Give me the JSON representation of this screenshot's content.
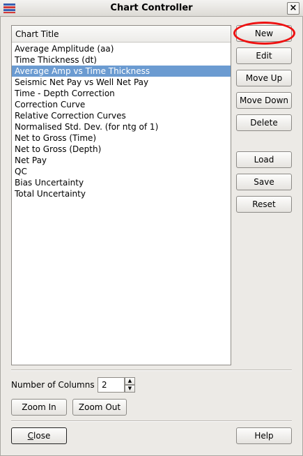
{
  "window": {
    "title": "Chart Controller",
    "close_glyph": "×"
  },
  "chart_list": {
    "header": "Chart Title",
    "items": [
      "Average Amplitude (aa)",
      "Time Thickness (dt)",
      "Average Amp vs Time Thickness",
      "Seismic Net Pay vs Well Net Pay",
      "Time - Depth Correction",
      "Correction Curve",
      "Relative Correction Curves",
      "Normalised Std. Dev. (for ntg of 1)",
      "Net to Gross (Time)",
      "Net to Gross (Depth)",
      "Net Pay",
      "QC",
      "Bias Uncertainty",
      "Total Uncertainty"
    ],
    "selected_index": 2
  },
  "side_buttons": {
    "new": "New",
    "edit": "Edit",
    "move_up": "Move Up",
    "move_down": "Move Down",
    "delete": "Delete",
    "load": "Load",
    "save": "Save",
    "reset": "Reset"
  },
  "columns": {
    "label": "Number of Columns",
    "value": "2",
    "up_glyph": "▲",
    "down_glyph": "▼"
  },
  "zoom": {
    "zoom_in": "Zoom In",
    "zoom_out": "Zoom Out"
  },
  "footer": {
    "close_first": "C",
    "close_rest": "lose",
    "help": "Help"
  },
  "colors": {
    "selection": "#6b9bd1",
    "highlight_ring": "#ee1111"
  }
}
